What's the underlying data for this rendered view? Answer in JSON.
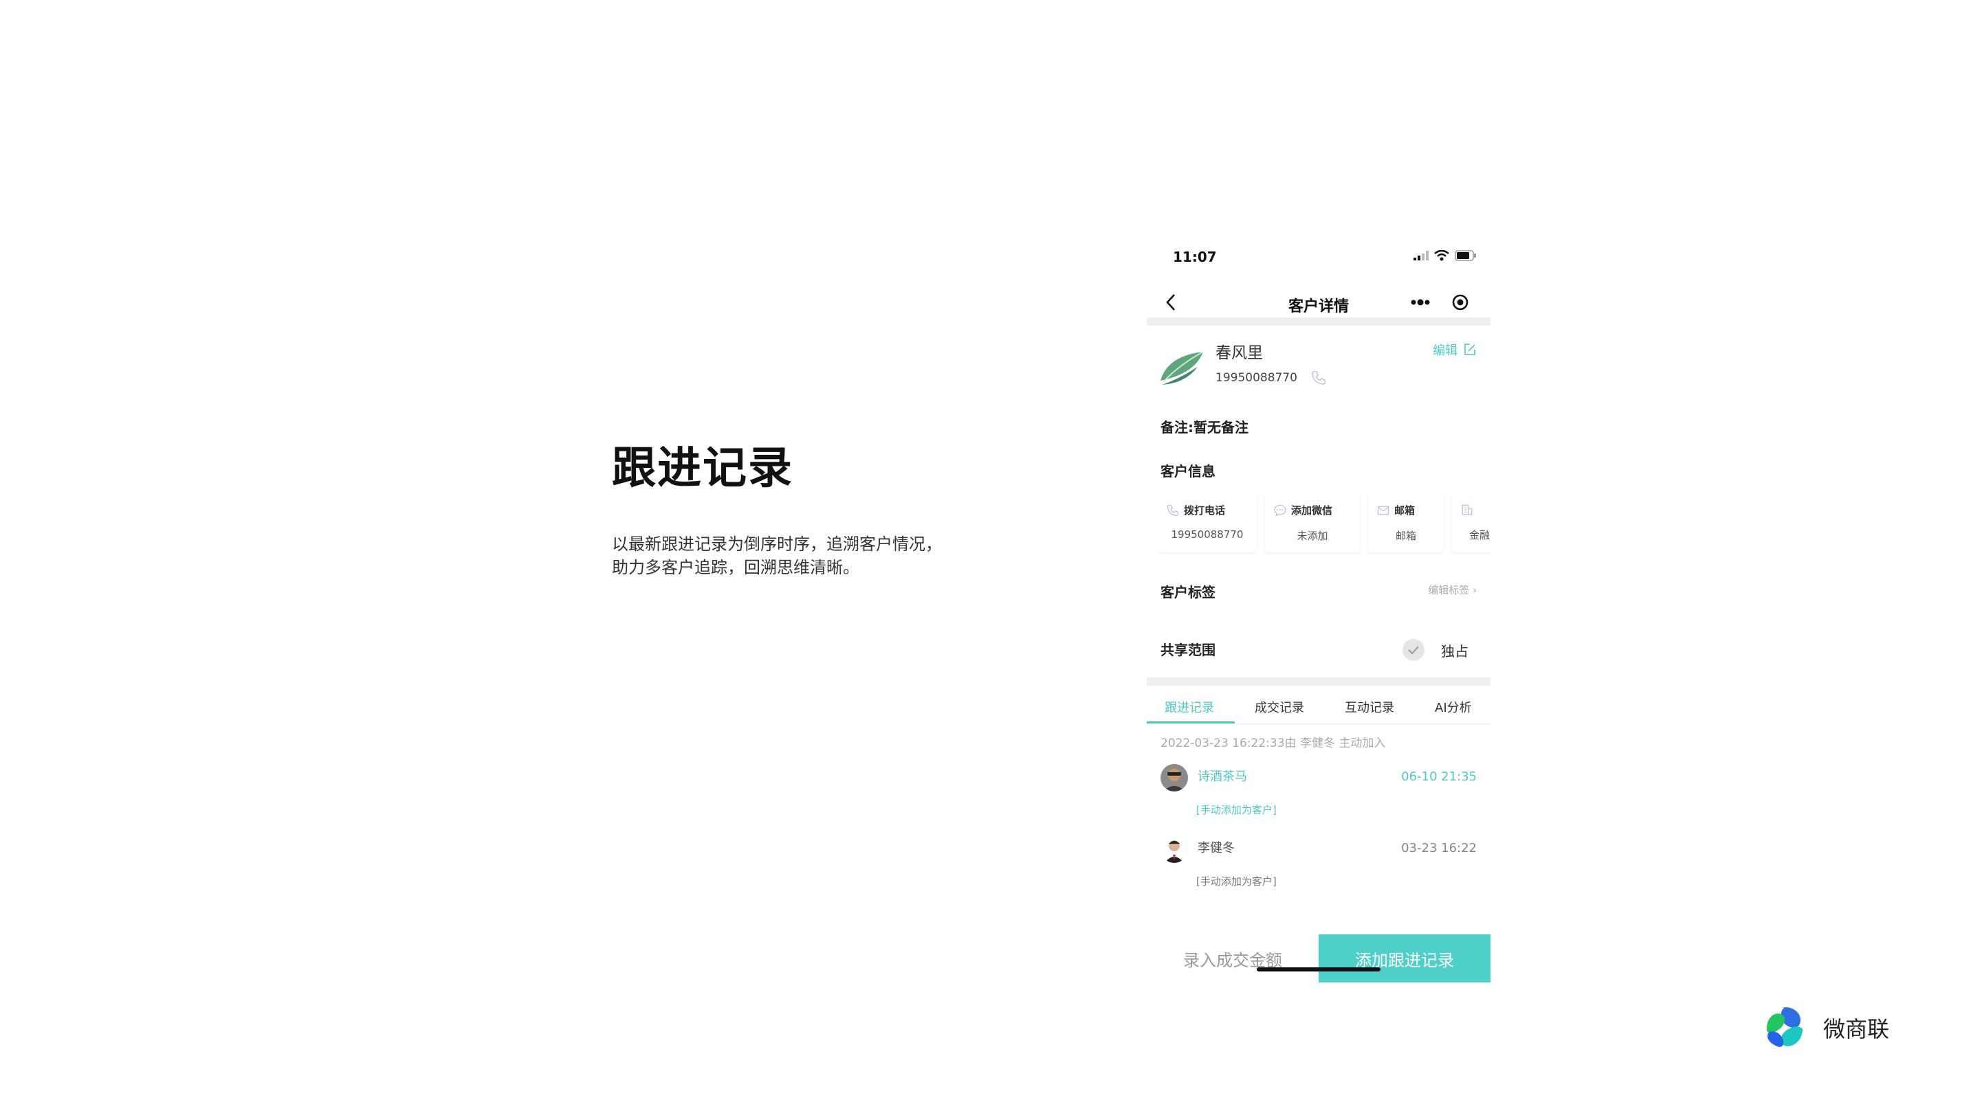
{
  "slide": {
    "title": "跟进记录",
    "desc_line1": "以最新跟进记录为倒序时序，追溯客户情况，",
    "desc_line2": "助力多客户追踪，回溯思维清晰。"
  },
  "status_bar": {
    "time": "11:07"
  },
  "nav": {
    "title": "客户详情",
    "back_icon": "chevron-left-icon",
    "more_icon": "more-dots-icon",
    "close_icon": "target-icon"
  },
  "customer": {
    "name": "春风里",
    "phone": "19950088770",
    "edit_label": "编辑"
  },
  "remark": "备注:暂无备注",
  "customer_info": {
    "heading": "客户信息",
    "cards": [
      {
        "icon": "phone-icon",
        "label": "拨打电话",
        "value": "19950088770"
      },
      {
        "icon": "chat-icon",
        "label": "添加微信",
        "value": "未添加"
      },
      {
        "icon": "mail-icon",
        "label": "邮箱",
        "value": "邮箱"
      },
      {
        "icon": "bank-icon",
        "label": "",
        "value": "金融"
      }
    ]
  },
  "tags": {
    "heading": "客户标签",
    "edit_label": "编辑标签 ›"
  },
  "share": {
    "label": "共享范围",
    "value": "独占"
  },
  "tabs": [
    "跟进记录",
    "成交记录",
    "互动记录",
    "AI分析"
  ],
  "active_tab": "跟进记录",
  "records_header": "2022-03-23 16:22:33由 李健冬 主动加入",
  "records": [
    {
      "name": "诗酒茶马",
      "time": "06-10 21:35",
      "note": "[手动添加为客户]",
      "color": "#4fc8c4"
    },
    {
      "name": "李健冬",
      "time": "03-23 16:22",
      "note": "[手动添加为客户]",
      "color": "#555555"
    }
  ],
  "bottom": {
    "left_label": "录入成交金额",
    "right_label": "添加跟进记录"
  },
  "brand": {
    "name": "微商联"
  },
  "colors": {
    "accent": "#4fc8c4",
    "button": "#4ecfc9"
  }
}
